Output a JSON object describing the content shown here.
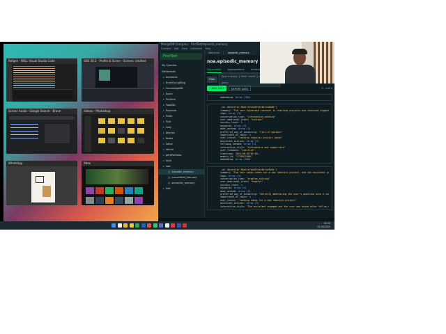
{
  "task_view": {
    "windows": [
      {
        "title": "Refgen - WSL: Visual Studio Code"
      },
      {
        "title": "OBS 30.2 - Profile & Scene - Scenes: Untitled"
      },
      {
        "title": "Screen Audio - Google Search - Brave"
      },
      {
        "title": "Videos - Photoshop"
      },
      {
        "title": "WhatsApp"
      },
      {
        "title": "Xbox"
      }
    ]
  },
  "compass": {
    "window_title": "MongoDB Compass - FirstTest/episodic_memory",
    "menu": [
      "Connect",
      "Edit",
      "View",
      "Collection",
      "Help"
    ],
    "connection_name": "FirstTest",
    "sidebar_heading_my_queries": "My Queries",
    "sidebar_heading_databases": "Databases",
    "databases": [
      "AnimeLib",
      "BrainDumpBlog",
      "CourseAppDB",
      "Ecom",
      "FiLiGam",
      "FoodDb",
      "Expense",
      "FinRe",
      "First",
      "Goly",
      "Kitchen",
      "Notes",
      "Solve",
      "admin",
      "giftsPortfolio",
      "local",
      "noa"
    ],
    "collections": [
      "episodic_memory",
      "procedural_memory",
      "semantic_memory"
    ],
    "after_noa": "test",
    "tabs": [
      "Welcome",
      "episodic_memory"
    ],
    "collection_title": "noa.episodic_memory",
    "sub_tabs": [
      "Documents",
      "Aggregations",
      "Schema"
    ],
    "filter_label": "Filter",
    "filter_placeholder": "Type a query: { field: 'value' } or Generate query",
    "explain_label": "Explain",
    "reset_label": "Reset",
    "find_label": "Find",
    "options_label": "Options",
    "add_data_label": "+ ADD DATA",
    "export_label": "EXPORT DATA",
    "pagination": "1 - 4 of 4",
    "documents": [
      {
        "fields": [
          {
            "k": "embedding",
            "v": "Array (384)",
            "t": "n"
          }
        ]
      },
      {
        "fields": [
          {
            "k": "_id",
            "v": "ObjectId('66a1fe5c4d5fe4c0e7cd3a8b')",
            "t": "v"
          },
          {
            "k": "summary",
            "v": "\"The user expressed interest in resolved projects and received suggested…\"",
            "t": "v"
          },
          {
            "k": "tags",
            "v": "Array (5)",
            "t": "n"
          },
          {
            "k": "conversation_type",
            "v": "\"information_seeking\"",
            "t": "v"
          },
          {
            "k": "user_emotional_state",
            "v": "\"curious\"",
            "t": "v"
          },
          {
            "k": "success_level",
            "v": "5",
            "t": "n"
          },
          {
            "k": "keywords",
            "v": "Array (3)",
            "t": "n"
          },
          {
            "k": "what_worked",
            "v": "Array (3)",
            "t": "n"
          },
          {
            "k": "preferred_way_of_answering",
            "v": "\"list of options\"",
            "t": "v"
          },
          {
            "k": "importance_of_topic",
            "v": "4",
            "t": "n"
          },
          {
            "k": "user_intent",
            "v": "\"seeking robotics project ideas\"",
            "t": "v"
          },
          {
            "k": "assistant_actions",
            "v": "Array (3)",
            "t": "n"
          },
          {
            "k": "followup_needed",
            "v": "Array (2)",
            "t": "n"
          },
          {
            "k": "interaction_style",
            "v": "\"informative and supportive\"",
            "t": "v"
          },
          {
            "k": "user_feedback",
            "v": "\"positive\"",
            "t": "v"
          },
          {
            "k": "timestamp",
            "v": "2024-08-01T02:09…",
            "t": "v"
          },
          {
            "k": "memory_id",
            "v": "\"1749911000\"",
            "t": "v"
          },
          {
            "k": "embedding",
            "v": "Array (384)",
            "t": "n"
          }
        ]
      },
      {
        "fields": [
          {
            "k": "_id",
            "v": "ObjectId('66a1fe7d4d5fe4c0e7cd3a8c')",
            "t": "v"
          },
          {
            "k": "summary",
            "v": "\"The user seeks ideas for a new robotics project, and the assistant pro…\"",
            "t": "v"
          },
          {
            "k": "tags",
            "v": "Array (5)",
            "t": "n"
          },
          {
            "k": "conversation_type",
            "v": "\"problem_solving\"",
            "t": "v"
          },
          {
            "k": "user_emotional_state",
            "v": "\"hopeful\"",
            "t": "v"
          },
          {
            "k": "success_level",
            "v": "4",
            "t": "n"
          },
          {
            "k": "keywords",
            "v": "Array (4)",
            "t": "n"
          },
          {
            "k": "what_worked",
            "v": "Array (2)",
            "t": "n"
          },
          {
            "k": "preferred_way_of_answering",
            "v": "\"directly addressing the user's question with a concise and informative\"",
            "t": "v"
          },
          {
            "k": "importance_of_topic",
            "v": "4",
            "t": "n"
          },
          {
            "k": "user_intent",
            "v": "\"looking ideas for a new robotics project\"",
            "t": "v"
          },
          {
            "k": "assistant_actions",
            "v": "Array (3)",
            "t": "n"
          },
          {
            "k": "interaction_style",
            "v": "\"The assistant engaged and the user was asked after follow-up…\"",
            "t": "v"
          }
        ]
      }
    ]
  },
  "taskbar": {
    "time": "02:10",
    "date": "01-08-2024",
    "icon_colors": [
      "#3d8ee8",
      "#f2f2f2",
      "#e8b83a",
      "#f0c040",
      "#2fa84f",
      "#1565c0",
      "#e74c3c",
      "#2ecc71",
      "#5c6bc0",
      "#eeeeee",
      "#e53935",
      "#3f51b5",
      "#d32f2f"
    ]
  },
  "colors": {
    "accent_green": "#00ed64",
    "compass_bg": "#0f1c21",
    "taskbar_bg": "#1c2a33"
  }
}
